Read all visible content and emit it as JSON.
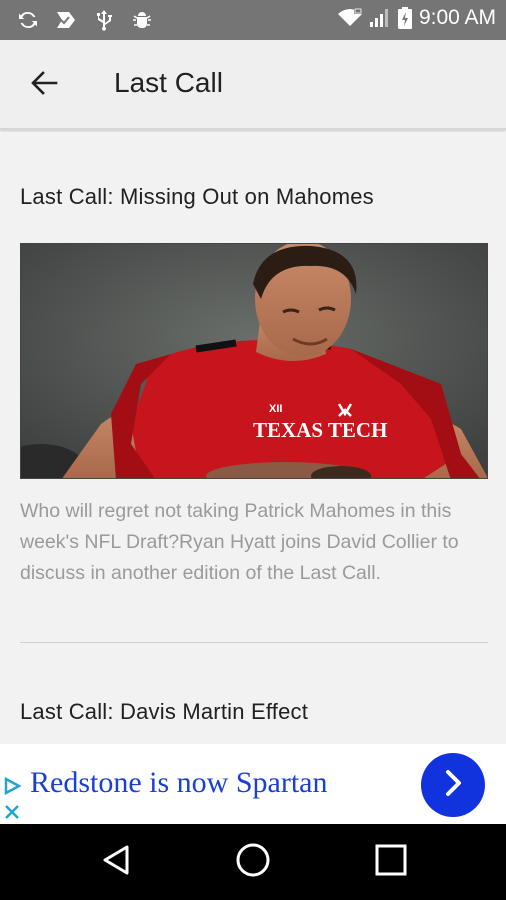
{
  "status_bar": {
    "time": "9:00 AM",
    "icons": [
      "sync-icon",
      "inbox-check-icon",
      "usb-icon",
      "android-debug-icon",
      "wifi-icon",
      "signal-icon",
      "battery-icon"
    ]
  },
  "app_bar": {
    "title": "Last Call",
    "back_icon": "back-arrow-icon"
  },
  "articles": [
    {
      "title": "Last Call: Missing Out on Mahomes",
      "summary": "Who will regret not taking Patrick Mahomes in this week's NFL Draft?Ryan Hyatt joins David Collier to discuss in another edition of the Last Call.",
      "image_jersey_text": "TEXAS TECH",
      "image_patch_text": "XII"
    },
    {
      "title": "Last Call: Davis Martin Effect"
    }
  ],
  "ad": {
    "text": "Redstone is now Spartan",
    "accent_color": "#1133dd",
    "icons": [
      "ad-choices-icon",
      "close-icon",
      "chevron-right-icon"
    ]
  },
  "nav_bar": {
    "icons": [
      "back-triangle-icon",
      "home-circle-icon",
      "recents-square-icon"
    ]
  },
  "colors": {
    "status_bar": "#757575",
    "app_bar": "#efefef",
    "background": "#f2f2f2",
    "summary_text": "#9a9a9a",
    "ad_text": "#1a3fd6"
  }
}
